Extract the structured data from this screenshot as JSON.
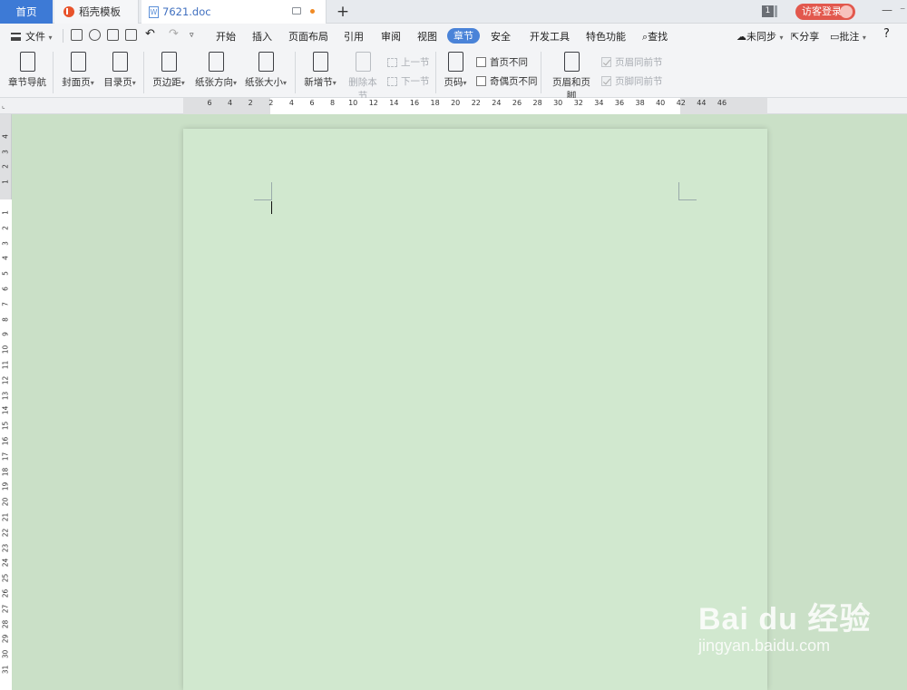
{
  "tabs": {
    "home": "首页",
    "template": "稻壳模板",
    "doc": "7621.doc",
    "new_tab_symbol": "+"
  },
  "window": {
    "badge": "1",
    "login": "访客登录",
    "minimize": "—",
    "more": "⁻"
  },
  "menu": {
    "file": "文件",
    "items": [
      "开始",
      "插入",
      "页面布局",
      "引用",
      "审阅",
      "视图",
      "章节",
      "安全",
      "开发工具",
      "特色功能"
    ],
    "search": "查找",
    "sync": "未同步",
    "share": "分享",
    "comment": "批注",
    "help": "?"
  },
  "ribbon": {
    "nav": "章节导航",
    "cover": "封面页",
    "toc": "目录页",
    "margin": "页边距",
    "orientation": "纸张方向",
    "size": "纸张大小",
    "new_section": "新增节",
    "delete_section": "删除本节",
    "prev_section": "上一节",
    "next_section": "下一节",
    "page_number": "页码",
    "first_page_diff": "首页不同",
    "odd_even_diff": "奇偶页不同",
    "header_footer": "页眉和页脚",
    "header_same_prev": "页眉同前节",
    "footer_same_prev": "页脚同前节"
  },
  "ruler_h": [
    "6",
    "4",
    "2",
    "2",
    "4",
    "6",
    "8",
    "10",
    "12",
    "14",
    "16",
    "18",
    "20",
    "22",
    "24",
    "26",
    "28",
    "30",
    "32",
    "34",
    "36",
    "38",
    "40",
    "42",
    "44",
    "46"
  ],
  "ruler_v_top": [
    "4",
    "3",
    "2",
    "1"
  ],
  "ruler_v": [
    "1",
    "2",
    "3",
    "4",
    "5",
    "6",
    "7",
    "8",
    "9",
    "10",
    "11",
    "12",
    "13",
    "14",
    "15",
    "16",
    "17",
    "18",
    "19",
    "20",
    "21",
    "22",
    "23",
    "24",
    "25",
    "26",
    "27",
    "28",
    "29",
    "30",
    "31"
  ],
  "watermark": {
    "brand": "Bai du 经验",
    "url": "jingyan.baidu.com"
  },
  "colors": {
    "accent": "#4a83d8",
    "login": "#e2584d",
    "page": "#d1e8cf"
  }
}
